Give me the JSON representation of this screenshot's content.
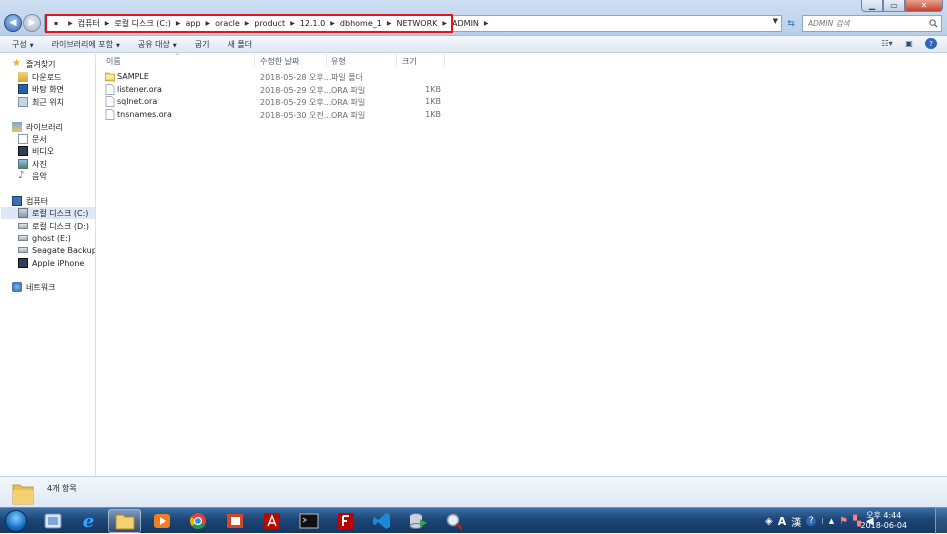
{
  "titlebar": {
    "controls": [
      "minimize-icon",
      "maximize-icon",
      "close-icon"
    ]
  },
  "address": {
    "crumbs": [
      "컴퓨터",
      "로컬 디스크 (C:)",
      "app",
      "oracle",
      "product",
      "12.1.0",
      "dbhome_1",
      "NETWORK",
      "ADMIN"
    ]
  },
  "search": {
    "placeholder": "ADMIN 검색"
  },
  "toolbar": {
    "organize": "구성",
    "include_library": "라이브러리에 포함",
    "share": "공유 대상",
    "burn": "굽기",
    "new_folder": "새 폴더"
  },
  "nav": {
    "favorites": "즐겨찾기",
    "downloads": "다운로드",
    "desktop": "바탕 화면",
    "recent": "최근 위치",
    "libraries": "라이브러리",
    "documents": "문서",
    "videos": "비디오",
    "pictures": "사진",
    "music": "음악",
    "computer": "컴퓨터",
    "drive_c": "로컬 디스크 (C:)",
    "drive_d": "로컬 디스크 (D:)",
    "drive_e": "ghost (E:)",
    "seagate": "Seagate Backup Plu",
    "iphone": "Apple iPhone",
    "network": "네트워크"
  },
  "columns": {
    "name": "이름",
    "date": "수정한 날짜",
    "type": "유형",
    "size": "크기"
  },
  "files": [
    {
      "name": "SAMPLE",
      "date": "2018-05-28 오후...",
      "type": "파일 폴더",
      "size": ""
    },
    {
      "name": "listener.ora",
      "date": "2018-05-29 오후...",
      "type": "ORA 파일",
      "size": "1KB"
    },
    {
      "name": "sqlnet.ora",
      "date": "2018-05-29 오후...",
      "type": "ORA 파일",
      "size": "1KB"
    },
    {
      "name": "tnsnames.ora",
      "date": "2018-05-30 오전...",
      "type": "ORA 파일",
      "size": "1KB"
    }
  ],
  "details": {
    "item_count": "4개 항목"
  },
  "taskbar": {
    "apps": [
      "windows-explorer-icon",
      "internet-explorer-icon",
      "file-explorer-icon",
      "media-player-icon",
      "chrome-icon",
      "ppt-icon",
      "acrobat-icon",
      "cmd-icon",
      "filezilla-icon",
      "visual-studio-code-icon",
      "sqldeveloper-icon",
      "magnifier-icon"
    ],
    "tray": {
      "ime": "A",
      "hanja": "漢",
      "time": "오후 4:44",
      "date": "2018-06-04"
    }
  },
  "colors": {
    "highlight_box": "#e3151b",
    "taskbar": "#1d4677",
    "selected_nav": "#dde8f6"
  }
}
